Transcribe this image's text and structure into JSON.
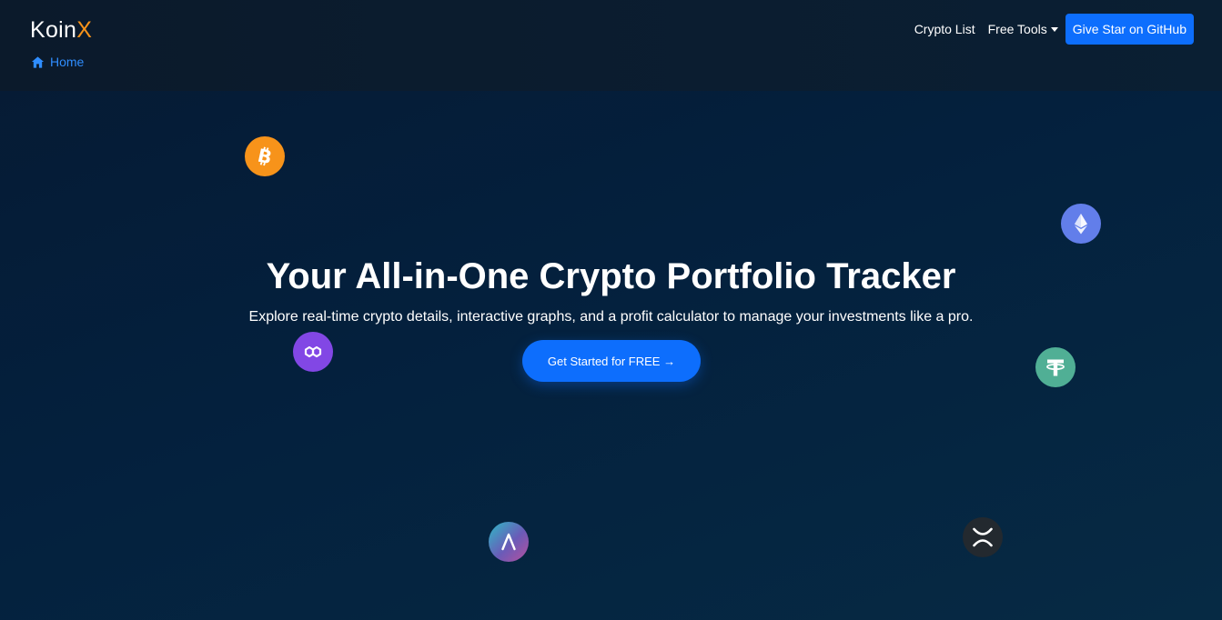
{
  "brand": {
    "name_main": "Koin",
    "name_accent": "X",
    "accent_color": "#f7931a"
  },
  "breadcrumb": {
    "home_label": "Home",
    "icon": "home-icon"
  },
  "nav": {
    "crypto_list_label": "Crypto List",
    "free_tools_label": "Free Tools",
    "github_button_label": "Give Star on GitHub"
  },
  "hero": {
    "title": "Your All-in-One Crypto Portfolio Tracker",
    "subtitle": "Explore real-time crypto details, interactive graphs, and a profit calculator to manage your investments like a pro.",
    "cta_label": "Get Started for FREE →"
  },
  "coins": [
    {
      "icon": "bitcoin-icon",
      "color": "#f7931a"
    },
    {
      "icon": "ethereum-icon",
      "color": "#627eea"
    },
    {
      "icon": "polygon-icon",
      "color": "#8247e5"
    },
    {
      "icon": "tether-icon",
      "color": "#50af95"
    },
    {
      "icon": "aave-icon",
      "color": "#b6509e"
    },
    {
      "icon": "xrp-icon",
      "color": "#23292f"
    }
  ],
  "colors": {
    "primary": "#0d6efd",
    "link": "#2f8dff",
    "background": "#04203d"
  }
}
